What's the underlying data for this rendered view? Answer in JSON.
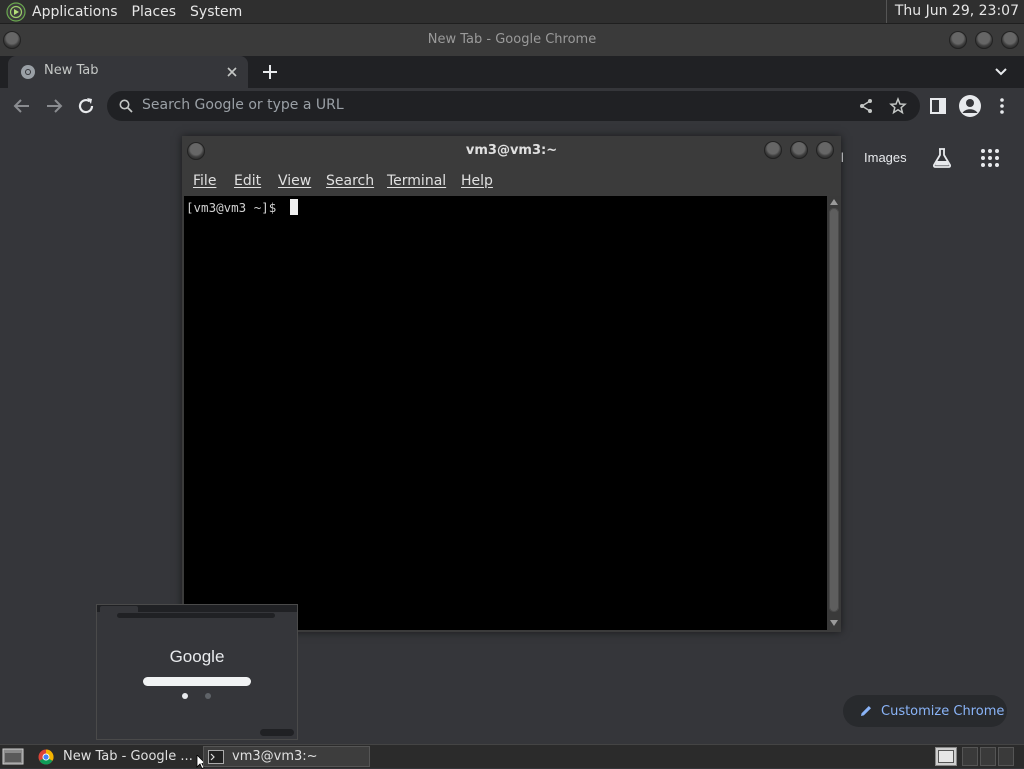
{
  "top_panel": {
    "menus": [
      "Applications",
      "Places",
      "System"
    ],
    "clock": "Thu Jun 29, 23:07"
  },
  "chrome": {
    "window_title": "New Tab - Google Chrome",
    "tab": {
      "title": "New Tab",
      "icon": "chrome-icon"
    },
    "omnibox_placeholder": "Search Google or type a URL",
    "ntp": {
      "links": [
        "il",
        "Images"
      ],
      "customize_label": "Customize Chrome"
    }
  },
  "terminal": {
    "title": "vm3@vm3:~",
    "menus": [
      "File",
      "Edit",
      "View",
      "Search",
      "Terminal",
      "Help"
    ],
    "prompt": "[vm3@vm3 ~]$"
  },
  "thumbnail": {
    "logo_text": "Google"
  },
  "taskbar": {
    "items": [
      {
        "label": "New Tab - Google ...",
        "icon": "chrome-icon",
        "active": false
      },
      {
        "label": "vm3@vm3:~",
        "icon": "terminal-icon",
        "active": true
      }
    ]
  },
  "colors": {
    "chrome_dark": "#35363a",
    "chrome_tabstrip": "#202124",
    "accent_blue": "#8ab4f8",
    "terminal_bg": "#000000"
  }
}
